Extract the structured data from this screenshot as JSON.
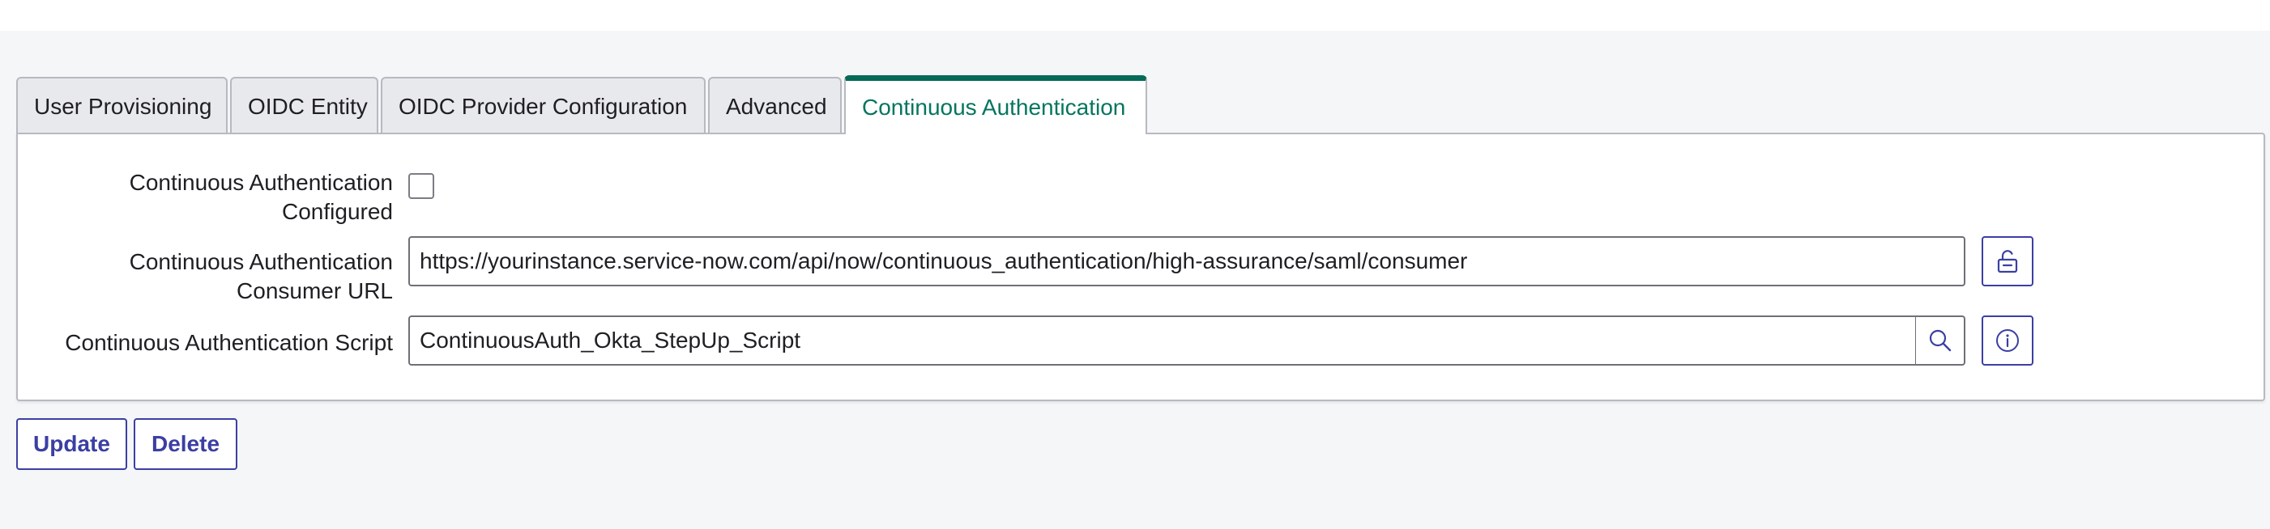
{
  "tabs": [
    {
      "label": "User Provisioning"
    },
    {
      "label": "OIDC Entity"
    },
    {
      "label": "OIDC Provider Configuration"
    },
    {
      "label": "Advanced"
    },
    {
      "label": "Continuous Authentication"
    }
  ],
  "form": {
    "configured_label_line1": "Continuous Authentication",
    "configured_label_line2": "Configured",
    "configured_checked": false,
    "consumer_url_label_line1": "Continuous Authentication",
    "consumer_url_label_line2": "Consumer URL",
    "consumer_url_value": "https://yourinstance.service-now.com/api/now/continuous_authentication/high-assurance/saml/consumer",
    "script_label": "Continuous Authentication Script",
    "script_value": "ContinuousAuth_Okta_StepUp_Script"
  },
  "actions": {
    "update_label": "Update",
    "delete_label": "Delete"
  },
  "icons": {
    "lock": "unlock-icon",
    "search": "search-icon",
    "info": "info-icon"
  },
  "colors": {
    "active_tab_accent": "#036b58",
    "active_tab_text": "#04755f",
    "button_primary": "#3b3fa3"
  }
}
